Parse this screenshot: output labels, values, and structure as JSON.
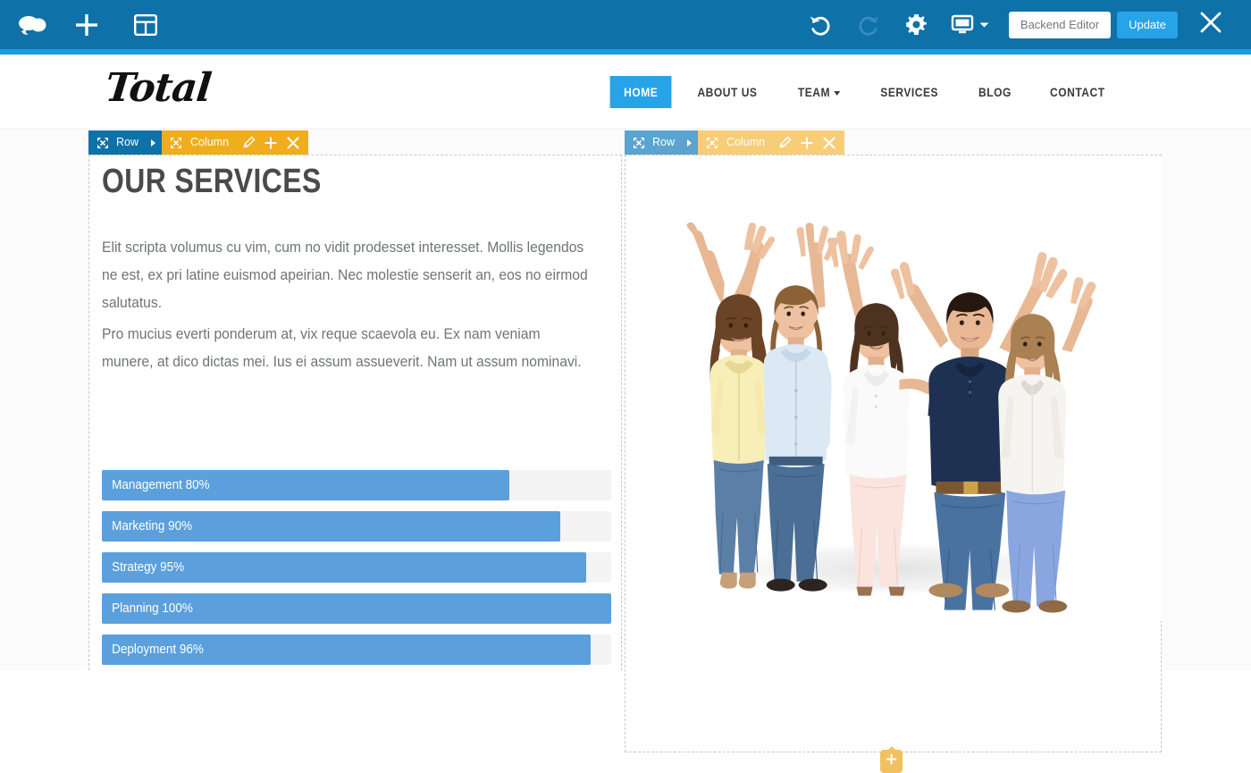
{
  "admin_bar": {
    "logo_icon": "cloud-icon",
    "add_icon": "plus-icon",
    "templates_icon": "layout-grid-icon",
    "undo_icon": "undo-arrow-icon",
    "redo_icon": "redo-arrow-icon",
    "settings_icon": "gear-icon",
    "responsive_icon": "monitor-icon",
    "backend_editor_label": "Backend Editor",
    "update_label": "Update",
    "close_icon": "close-x-icon",
    "bg_color": "#0e71a8",
    "accent_color": "#1e9ae0",
    "update_button_color": "#27a3e8"
  },
  "site_header": {
    "logo_text": "Total",
    "nav": [
      {
        "label": "HOME",
        "active": true,
        "has_dropdown": false
      },
      {
        "label": "ABOUT US",
        "active": false,
        "has_dropdown": false
      },
      {
        "label": "TEAM",
        "active": false,
        "has_dropdown": true
      },
      {
        "label": "SERVICES",
        "active": false,
        "has_dropdown": false
      },
      {
        "label": "BLOG",
        "active": false,
        "has_dropdown": false
      },
      {
        "label": "CONTACT",
        "active": false,
        "has_dropdown": false
      }
    ],
    "active_nav_color": "#27a3e8"
  },
  "builder": {
    "left_controls": {
      "row_label": "Row",
      "column_label": "Column",
      "row_color": "#0e71a8",
      "column_color": "#f0ad1e",
      "drag_icon": "move-arrows-icon",
      "row_arrow_icon": "chevron-right-icon",
      "edit_icon": "pencil-icon",
      "add_icon": "plus-icon",
      "delete_icon": "close-x-icon"
    },
    "right_controls": {
      "row_label": "Row",
      "column_label": "Column",
      "row_color": "#5ba3d0",
      "column_color": "#f7cd77",
      "drag_icon": "move-arrows-icon",
      "row_arrow_icon": "chevron-right-icon",
      "edit_icon": "pencil-icon",
      "add_icon": "plus-icon",
      "delete_icon": "close-x-icon"
    },
    "add_element_icon": "plus-icon",
    "add_element_color": "#f2c15f"
  },
  "content": {
    "heading": "OUR SERVICES",
    "paragraph_1": "Elit scripta volumus cu vim, cum no vidit prodesset interesset. Mollis legendos ne est, ex pri latine euismod apeirian. Nec molestie senserit an, eos no eirmod salutatus.",
    "paragraph_2": "Pro mucius everti ponderum at, vix reque scaevola eu. Ex nam veniam munere, at dico dictas mei. Ius ei assum assueverit. Nam ut assum nominavi.",
    "image_alt": "Group of five happy people with arms raised celebrating"
  },
  "chart_data": {
    "type": "bar",
    "title": "",
    "orientation": "horizontal",
    "categories": [
      "Management",
      "Marketing",
      "Strategy",
      "Planning",
      "Deployment"
    ],
    "values": [
      80,
      90,
      95,
      100,
      96
    ],
    "labels": [
      "Management 80%",
      "Marketing 90%",
      "Strategy 95%",
      "Planning 100%",
      "Deployment 96%"
    ],
    "xlim": [
      0,
      100
    ],
    "xlabel": "",
    "ylabel": "",
    "grid": false,
    "legend": "none",
    "bar_color": "#5ba0dc",
    "track_color": "#f4f4f4",
    "label_color": "#ffffff"
  }
}
